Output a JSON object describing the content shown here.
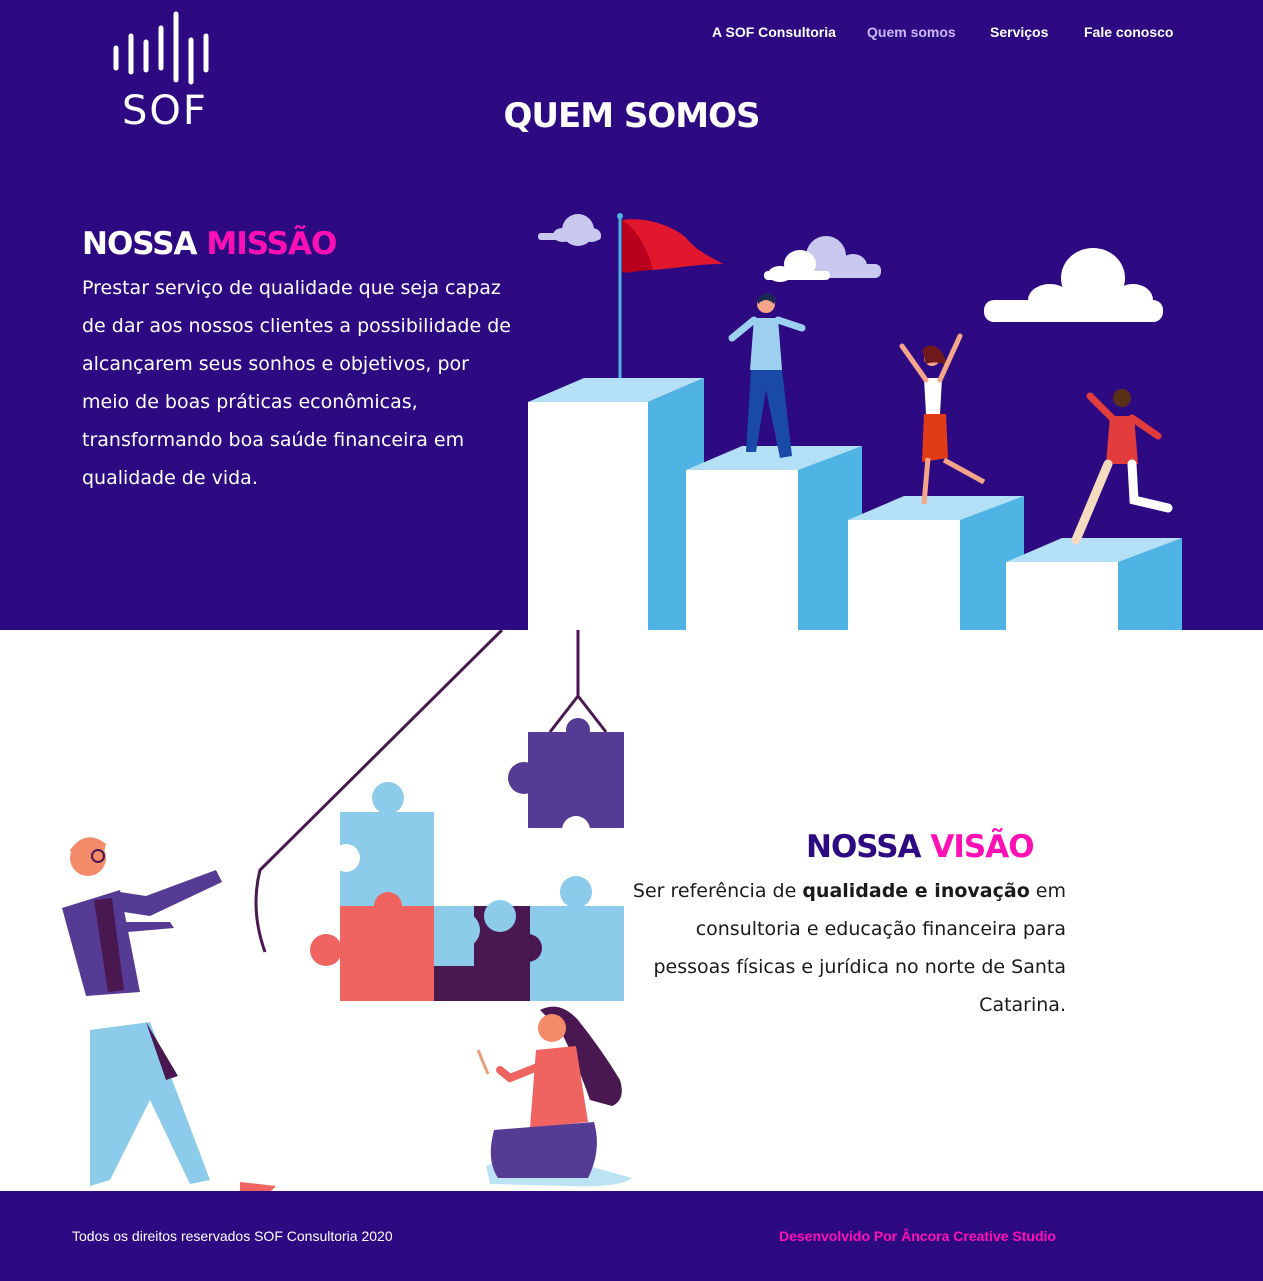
{
  "brand": {
    "logo_text": "SOF"
  },
  "nav": {
    "items": [
      {
        "label": "A SOF Consultoria"
      },
      {
        "label": "Quem somos",
        "active": true
      },
      {
        "label": "Serviços"
      },
      {
        "label": "Fale conosco"
      }
    ]
  },
  "page_title": "QUEM SOMOS",
  "mission": {
    "title_part1": "NOSSA ",
    "title_part2": "MISSÃO",
    "text": "Prestar serviço de qualidade que seja capaz de dar aos nossos clientes a possibilidade de alcançarem seus sonhos e objetivos, por meio de boas práticas econômicas, transformando boa saúde financeira em qualidade de vida."
  },
  "vision": {
    "title_part1": "NOSSA ",
    "title_part2": "VISÃO",
    "text_before": "Ser referência de ",
    "text_bold": "qualidade e inovação",
    "text_after": " em consultoria e educação financeira para pessoas físicas e jurídica no norte de Santa Catarina."
  },
  "footer": {
    "copyright": "Todos os direitos reservados SOF Consultoria 2020",
    "credit": "Desenvolvido Por Âncora Creative Studio"
  },
  "colors": {
    "primary": "#2e0a82",
    "accent": "#ff10b4",
    "step_side": "#4fb3e3",
    "step_top": "#b3e0f7",
    "puzzle_light": "#8ccbea",
    "puzzle_red": "#ef6461",
    "puzzle_purple": "#563b94",
    "puzzle_dark": "#4a1850"
  }
}
